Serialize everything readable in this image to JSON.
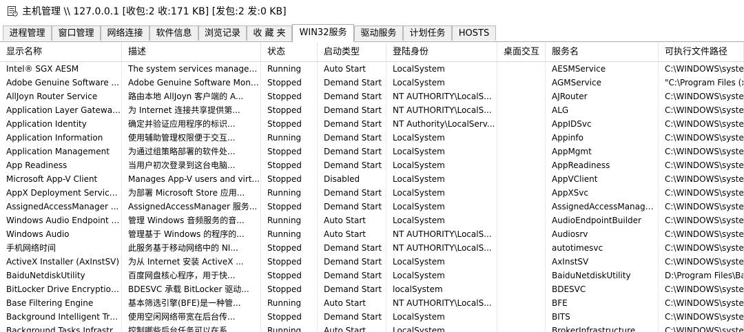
{
  "window": {
    "title": "主机管理 \\\\ 127.0.0.1  [收包:2 收:171 KB] [发包:2 发:0 KB]"
  },
  "icons": {
    "app": "server-monitor-icon"
  },
  "tabs": [
    {
      "label": "进程管理",
      "active": false
    },
    {
      "label": "窗口管理",
      "active": false
    },
    {
      "label": "网络连接",
      "active": false
    },
    {
      "label": "软件信息",
      "active": false
    },
    {
      "label": "浏览记录",
      "active": false
    },
    {
      "label": "收 藏 夹",
      "active": false
    },
    {
      "label": "WIN32服务",
      "active": true
    },
    {
      "label": "驱动服务",
      "active": false
    },
    {
      "label": "计划任务",
      "active": false
    },
    {
      "label": "HOSTS",
      "active": false
    }
  ],
  "table": {
    "columns": [
      "显示名称",
      "描述",
      "状态",
      "启动类型",
      "登陆身份",
      "桌面交互",
      "服务名",
      "可执行文件路径"
    ],
    "rows": [
      [
        "Intel® SGX AESM",
        "The system services managem...",
        "Running",
        "Auto Start",
        "LocalSystem",
        "",
        "AESMService",
        "C:\\WINDOWS\\syste"
      ],
      [
        "Adobe Genuine Software ...",
        "Adobe Genuine Software Moni...",
        "Stopped",
        "Demand Start",
        "LocalSystem",
        "",
        "AGMService",
        "\"C:\\Program Files (x"
      ],
      [
        "AllJoyn Router Service",
        "路由本地 AllJoyn 客户端的 A...",
        "Stopped",
        "Demand Start",
        "NT AUTHORITY\\LocalS...",
        "",
        "AJRouter",
        "C:\\WINDOWS\\syste"
      ],
      [
        "Application Layer Gateway...",
        "为 Internet 连接共享提供第...",
        "Stopped",
        "Demand Start",
        "NT AUTHORITY\\LocalS...",
        "",
        "ALG",
        "C:\\WINDOWS\\syste"
      ],
      [
        "Application Identity",
        "确定并验证应用程序的标识...",
        "Stopped",
        "Demand Start",
        "NT Authority\\LocalServ...",
        "",
        "AppIDSvc",
        "C:\\WINDOWS\\syste"
      ],
      [
        "Application Information",
        "使用辅助管理权限便于交互...",
        "Running",
        "Demand Start",
        "LocalSystem",
        "",
        "Appinfo",
        "C:\\WINDOWS\\syste"
      ],
      [
        "Application Management",
        "为通过组策略部署的软件处...",
        "Stopped",
        "Demand Start",
        "LocalSystem",
        "",
        "AppMgmt",
        "C:\\WINDOWS\\syste"
      ],
      [
        "App Readiness",
        "当用户初次登录到这台电脑...",
        "Stopped",
        "Demand Start",
        "LocalSystem",
        "",
        "AppReadiness",
        "C:\\WINDOWS\\syste"
      ],
      [
        "Microsoft App-V Client",
        "Manages App-V users and virt...",
        "Stopped",
        "Disabled",
        "LocalSystem",
        "",
        "AppVClient",
        "C:\\WINDOWS\\syste"
      ],
      [
        "AppX Deployment Service (...",
        "为部署 Microsoft Store 应用...",
        "Running",
        "Demand Start",
        "LocalSystem",
        "",
        "AppXSvc",
        "C:\\WINDOWS\\syste"
      ],
      [
        "AssignedAccessManager ...",
        "AssignedAccessManager 服务...",
        "Stopped",
        "Demand Start",
        "LocalSystem",
        "",
        "AssignedAccessManage...",
        "C:\\WINDOWS\\syste"
      ],
      [
        "Windows Audio Endpoint B...",
        "管理 Windows 音频服务的音...",
        "Running",
        "Auto Start",
        "LocalSystem",
        "",
        "AudioEndpointBuilder",
        "C:\\WINDOWS\\syste"
      ],
      [
        "Windows Audio",
        "管理基于 Windows 的程序的...",
        "Running",
        "Auto Start",
        "NT AUTHORITY\\LocalS...",
        "",
        "Audiosrv",
        "C:\\WINDOWS\\syste"
      ],
      [
        "手机网络时间",
        "此服务基于移动网络中的 NI...",
        "Stopped",
        "Demand Start",
        "NT AUTHORITY\\LocalS...",
        "",
        "autotimesvc",
        "C:\\WINDOWS\\syste"
      ],
      [
        "ActiveX Installer (AxInstSV)",
        "为从 Internet 安装 ActiveX ...",
        "Stopped",
        "Demand Start",
        "LocalSystem",
        "",
        "AxInstSV",
        "C:\\WINDOWS\\syste"
      ],
      [
        "BaiduNetdiskUtility",
        "百度网盘核心程序，用于快...",
        "Stopped",
        "Demand Start",
        "LocalSystem",
        "",
        "BaiduNetdiskUtility",
        "D:\\Program Files\\Bai"
      ],
      [
        "BitLocker Drive Encryption ...",
        "BDESVC 承载 BitLocker 驱动...",
        "Stopped",
        "Demand Start",
        "localSystem",
        "",
        "BDESVC",
        "C:\\WINDOWS\\syste"
      ],
      [
        "Base Filtering Engine",
        "基本筛选引擎(BFE)是一种管...",
        "Running",
        "Auto Start",
        "NT AUTHORITY\\LocalS...",
        "",
        "BFE",
        "C:\\WINDOWS\\syste"
      ],
      [
        "Background Intelligent Tra...",
        "使用空闲网络带宽在后台传...",
        "Stopped",
        "Demand Start",
        "LocalSystem",
        "",
        "BITS",
        "C:\\WINDOWS\\syste"
      ],
      [
        "Background Tasks Infrastr...",
        "控制哪些后台任务可以在系...",
        "Running",
        "Auto Start",
        "LocalSystem",
        "",
        "BrokerInfrastructure",
        "C:\\WINDOWS\\syste"
      ]
    ]
  }
}
